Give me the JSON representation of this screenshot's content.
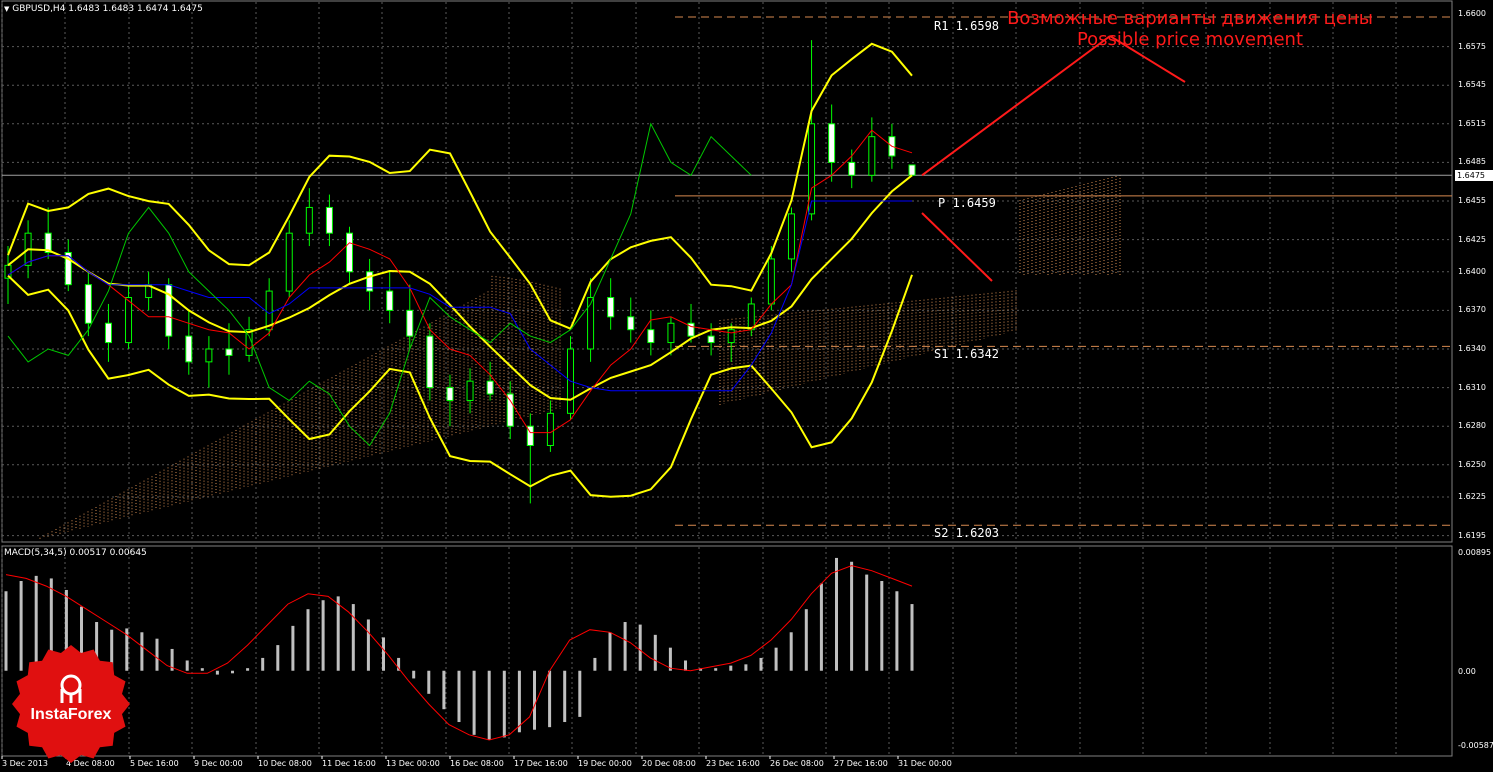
{
  "window": {
    "title": "GBPUSD,H4  1.6483 1.6483 1.6474 1.6475",
    "indicator_title": "MACD(5,34,5) 0.00517 0.00645",
    "current_price_tag": "1.6475"
  },
  "annotation": {
    "line1": "Возможные варианты движения цены",
    "line2": "Possible price movement"
  },
  "levels": [
    {
      "name": "R1",
      "label": "R1 1.6598",
      "price": 1.6598
    },
    {
      "name": "P",
      "label": "P 1.6459",
      "price": 1.6459
    },
    {
      "name": "S1",
      "label": "S1 1.6342",
      "price": 1.6342
    },
    {
      "name": "S2",
      "label": "S2 1.6203",
      "price": 1.6203
    }
  ],
  "price_axis": [
    "1.6600",
    "1.6575",
    "1.6545",
    "1.6515",
    "1.6485",
    "1.6455",
    "1.6425",
    "1.6400",
    "1.6370",
    "1.6340",
    "1.6310",
    "1.6280",
    "1.6250",
    "1.6225",
    "1.6195"
  ],
  "macd_axis": [
    "0.00895",
    "0.00",
    "-0.00587"
  ],
  "time_axis": [
    "3 Dec 2013",
    "4 Dec 08:00",
    "5 Dec 16:00",
    "9 Dec 00:00",
    "10 Dec 08:00",
    "11 Dec 16:00",
    "13 Dec 00:00",
    "16 Dec 08:00",
    "17 Dec 16:00",
    "19 Dec 00:00",
    "20 Dec 08:00",
    "23 Dec 16:00",
    "26 Dec 08:00",
    "27 Dec 16:00",
    "31 Dec 00:00"
  ],
  "logo": {
    "text": "InstaForex"
  },
  "colors": {
    "background": "#000000",
    "grid": "#5a5a5a",
    "candle": "#00ff00",
    "bollinger": "#ffff00",
    "kijun": "#0000ff",
    "tenkan": "#ff0000",
    "chikou": "#00c800",
    "cloud": "#d08a50",
    "levels": "#d88a50",
    "forecast": "#ff1a1a",
    "macd_hist": "#c0c0c0",
    "macd_signal": "#ff0000",
    "logo": "#e01010"
  },
  "chart_data": {
    "type": "candlestick",
    "symbol": "GBPUSD",
    "timeframe": "H4",
    "ylim": [
      1.619,
      1.6605
    ],
    "candles": [
      [
        1.6395,
        1.642,
        1.6375,
        1.6405
      ],
      [
        1.6405,
        1.644,
        1.6395,
        1.643
      ],
      [
        1.643,
        1.645,
        1.641,
        1.6415
      ],
      [
        1.6415,
        1.6425,
        1.6385,
        1.639
      ],
      [
        1.639,
        1.64,
        1.635,
        1.636
      ],
      [
        1.636,
        1.6375,
        1.633,
        1.6345
      ],
      [
        1.6345,
        1.639,
        1.634,
        1.638
      ],
      [
        1.638,
        1.64,
        1.637,
        1.639
      ],
      [
        1.639,
        1.6395,
        1.634,
        1.635
      ],
      [
        1.635,
        1.637,
        1.632,
        1.633
      ],
      [
        1.633,
        1.635,
        1.631,
        1.634
      ],
      [
        1.634,
        1.636,
        1.632,
        1.6335
      ],
      [
        1.6335,
        1.6365,
        1.633,
        1.6355
      ],
      [
        1.6355,
        1.6395,
        1.635,
        1.6385
      ],
      [
        1.6385,
        1.644,
        1.638,
        1.643
      ],
      [
        1.643,
        1.6465,
        1.642,
        1.645
      ],
      [
        1.645,
        1.646,
        1.642,
        1.643
      ],
      [
        1.643,
        1.6435,
        1.639,
        1.64
      ],
      [
        1.64,
        1.641,
        1.637,
        1.6385
      ],
      [
        1.6385,
        1.64,
        1.636,
        1.637
      ],
      [
        1.637,
        1.639,
        1.634,
        1.635
      ],
      [
        1.635,
        1.636,
        1.63,
        1.631
      ],
      [
        1.631,
        1.632,
        1.628,
        1.63
      ],
      [
        1.63,
        1.6325,
        1.629,
        1.6315
      ],
      [
        1.6315,
        1.633,
        1.63,
        1.6305
      ],
      [
        1.6305,
        1.6315,
        1.627,
        1.628
      ],
      [
        1.628,
        1.629,
        1.622,
        1.6265
      ],
      [
        1.6265,
        1.63,
        1.626,
        1.629
      ],
      [
        1.629,
        1.635,
        1.6285,
        1.634
      ],
      [
        1.634,
        1.6395,
        1.633,
        1.638
      ],
      [
        1.638,
        1.6395,
        1.6355,
        1.6365
      ],
      [
        1.6365,
        1.638,
        1.6345,
        1.6355
      ],
      [
        1.6355,
        1.637,
        1.6335,
        1.6345
      ],
      [
        1.6345,
        1.6365,
        1.6335,
        1.636
      ],
      [
        1.636,
        1.6375,
        1.6345,
        1.635
      ],
      [
        1.635,
        1.636,
        1.6335,
        1.6345
      ],
      [
        1.6345,
        1.636,
        1.633,
        1.6355
      ],
      [
        1.6355,
        1.638,
        1.635,
        1.6375
      ],
      [
        1.6375,
        1.642,
        1.637,
        1.641
      ],
      [
        1.641,
        1.645,
        1.64,
        1.6445
      ],
      [
        1.6445,
        1.658,
        1.644,
        1.6515
      ],
      [
        1.6515,
        1.653,
        1.647,
        1.6485
      ],
      [
        1.6485,
        1.6495,
        1.6465,
        1.6475
      ],
      [
        1.6475,
        1.652,
        1.647,
        1.6505
      ],
      [
        1.6505,
        1.6515,
        1.648,
        1.649
      ],
      [
        1.6483,
        1.6483,
        1.6474,
        1.6475
      ]
    ],
    "macd": {
      "title": "MACD(5,34,5)",
      "main": 0.00517,
      "signal": 0.00645,
      "ylim": [
        -0.00587,
        0.00895
      ],
      "histogram": [
        0.0062,
        0.007,
        0.0074,
        0.0072,
        0.0063,
        0.005,
        0.0038,
        0.0032,
        0.0033,
        0.003,
        0.0025,
        0.0017,
        0.0008,
        0.0002,
        -0.0003,
        -0.0002,
        0.0002,
        0.001,
        0.002,
        0.0035,
        0.0048,
        0.0055,
        0.0058,
        0.0052,
        0.004,
        0.0026,
        0.001,
        -0.0006,
        -0.0018,
        -0.003,
        -0.004,
        -0.005,
        -0.0054,
        -0.0052,
        -0.0048,
        -0.0046,
        -0.0044,
        -0.004,
        -0.0036,
        0.001,
        0.003,
        0.0038,
        0.0036,
        0.0028,
        0.0018,
        0.0008,
        0.0002,
        0.0002,
        0.0004,
        0.0005,
        0.001,
        0.0018,
        0.003,
        0.0048,
        0.0068,
        0.0088,
        0.0085,
        0.0075,
        0.007,
        0.0062,
        0.0052
      ],
      "signal_series": [
        0.0075,
        0.0072,
        0.0066,
        0.0058,
        0.0048,
        0.0038,
        0.0028,
        0.0016,
        0.0004,
        -0.0002,
        -0.0002,
        0.0006,
        0.002,
        0.0036,
        0.0052,
        0.006,
        0.0058,
        0.0046,
        0.003,
        0.0012,
        -0.0008,
        -0.0026,
        -0.0042,
        -0.005,
        -0.0054,
        -0.005,
        -0.0036,
        0.0,
        0.0024,
        0.0032,
        0.003,
        0.0022,
        0.001,
        0.0002,
        0.0,
        0.0003,
        0.0006,
        0.0012,
        0.0024,
        0.004,
        0.006,
        0.0076,
        0.0082,
        0.0078,
        0.0072,
        0.0066
      ]
    }
  }
}
